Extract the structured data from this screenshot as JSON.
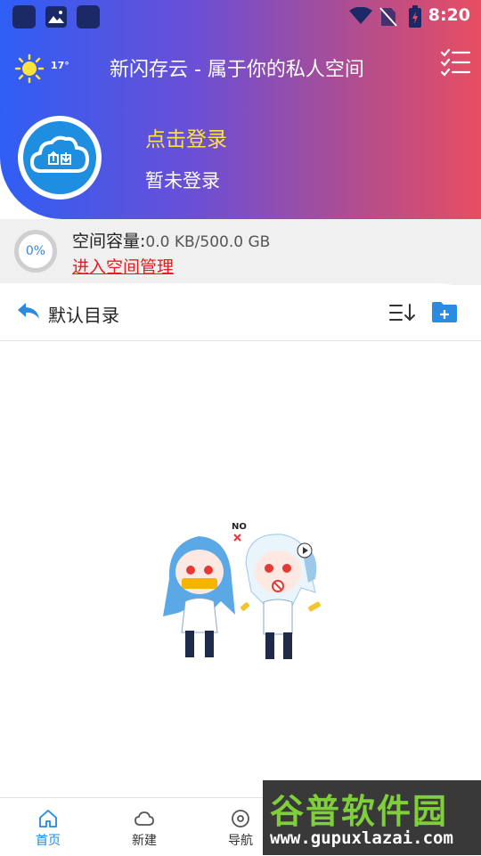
{
  "status_bar": {
    "time": "8:20"
  },
  "header": {
    "weather_temp": "17°",
    "title": "新闪存云 - 属于你的私人空间",
    "login_link": "点击登录",
    "login_status": "暂未登录"
  },
  "storage": {
    "percent_label": "0%",
    "usage_fraction": 0,
    "label": "空间容量:",
    "value": "0.0 KB/500.0 GB",
    "manage_link": "进入空间管理"
  },
  "directory": {
    "title": "默认目录"
  },
  "empty_state": {
    "badge_text": "NO"
  },
  "bottom_nav": {
    "items": [
      {
        "label": "首页",
        "icon": "home-icon",
        "active": true
      },
      {
        "label": "新建",
        "icon": "cloud-icon",
        "active": false
      },
      {
        "label": "导航",
        "icon": "compass-icon",
        "active": false
      }
    ]
  },
  "watermark": {
    "title": "谷普软件园",
    "url": "www.gupuxlazai.com"
  },
  "colors": {
    "header_gradient_start": "#2f5ef4",
    "header_gradient_end": "#e84d62",
    "login_link": "#ffe23c",
    "manage_link": "#e41e1e",
    "accent_blue": "#1e88e5"
  }
}
